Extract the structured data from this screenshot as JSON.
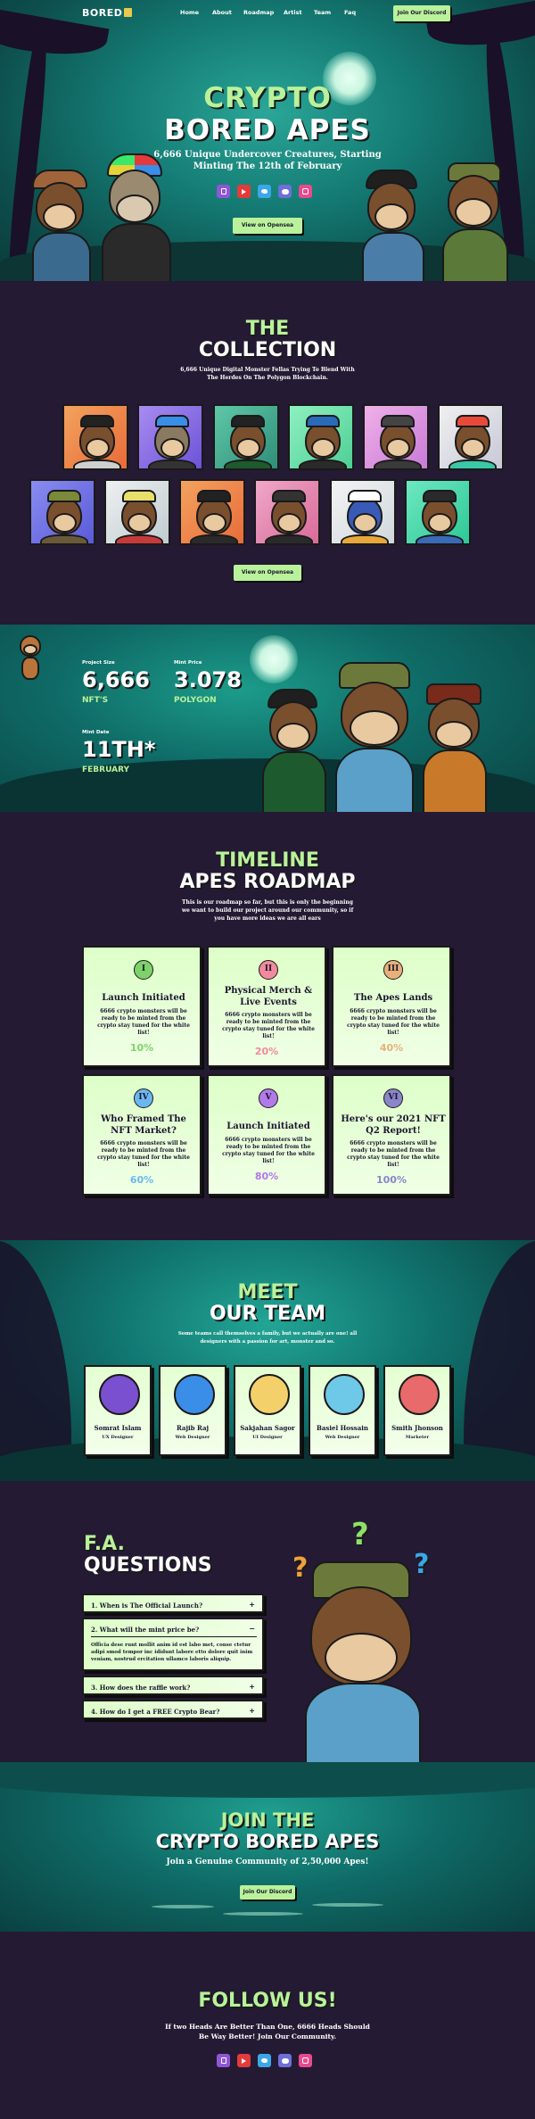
{
  "nav": {
    "logo": "BORED",
    "links": [
      "Home",
      "About",
      "Roadmap",
      "Artist",
      "Team",
      "Faq"
    ],
    "cta": "Join Our Discord"
  },
  "hero": {
    "title_line1": "CRYPTO",
    "title_line2": "BORED APES",
    "subtitle_line1": "6,666 Unique Undercover Creatures, Starting",
    "subtitle_line2": "Minting The 12th of February",
    "social_icons": [
      "twitch-icon",
      "youtube-icon",
      "twitter-icon",
      "discord-icon",
      "instagram-icon"
    ],
    "cta": "View on Opensea"
  },
  "collection": {
    "title_line1": "THE",
    "title_line2": "COLLECTION",
    "desc_line1": "6,666 Unique Digital Monster Fellas Trying To Blend With",
    "desc_line2": "The Herdes On The Polygon Blockchain.",
    "cta": "View on Opensea"
  },
  "stats": {
    "project_size_label": "Project Size",
    "project_size_value": "6,666",
    "project_size_unit": "NFT'S",
    "mint_price_label": "Mint Price",
    "mint_price_value": "3.078",
    "mint_price_unit": "POLYGON",
    "mint_date_label": "Mint Date",
    "mint_date_value": "11TH*",
    "mint_date_unit": "FEBRUARY"
  },
  "roadmap": {
    "title_line1": "TIMELINE",
    "title_line2": "APES ROADMAP",
    "desc_line1": "This is our roadmap so far, but this is only the beginning",
    "desc_line2": "we want to build our project around our community, so if",
    "desc_line3": "you have more ideas we are all ears",
    "items": [
      {
        "num": "I",
        "title": "Launch Initiated",
        "desc": "6666 crypto monsters will be ready to be minted from the crypto stay tuned for the white list!",
        "pct": "10%",
        "color": "#7dd36a"
      },
      {
        "num": "II",
        "title": "Physical Merch & Live Events",
        "desc": "6666 crypto monsters will be ready to be minted from the crypto stay tuned for the white list!",
        "pct": "20%",
        "color": "#f08a9c"
      },
      {
        "num": "III",
        "title": "The Apes Lands",
        "desc": "6666 crypto monsters will be ready to be minted from the crypto stay tuned for the white list!",
        "pct": "40%",
        "color": "#e8b07a"
      },
      {
        "num": "IV",
        "title": "Who Framed The NFT Market?",
        "desc": "6666 crypto monsters will be ready to be minted from the crypto stay tuned for the white list!",
        "pct": "60%",
        "color": "#6bb8f0"
      },
      {
        "num": "V",
        "title": "Launch Initiated",
        "desc": "6666 crypto monsters will be ready to be minted from the crypto stay tuned for the white list!",
        "pct": "80%",
        "color": "#b279e8"
      },
      {
        "num": "VI",
        "title": "Here's our 2021 NFT Q2 Report!",
        "desc": "6666 crypto monsters will be ready to be minted from the crypto stay tuned for the white list!",
        "pct": "100%",
        "color": "#8a86c8"
      }
    ]
  },
  "team": {
    "title_line1": "MEET",
    "title_line2": "OUR TEAM",
    "desc_line1": "Some teams call themselves a family, but we actually are one! all",
    "desc_line2": "designers with a passion for art, monster and so.",
    "members": [
      {
        "name": "Somrat Islam",
        "role": "UX Designer"
      },
      {
        "name": "Rajib Raj",
        "role": "Web Designer"
      },
      {
        "name": "Sakjahan Sagor",
        "role": "UI Designer"
      },
      {
        "name": "Basiel Hossain",
        "role": "Web Designer"
      },
      {
        "name": "Smith Jhonson",
        "role": "Marketer"
      }
    ]
  },
  "faq": {
    "title_line1": "F.A.",
    "title_line2": "QUESTIONS",
    "items": [
      {
        "q": "1. When is The Official Launch?",
        "a": ""
      },
      {
        "q": "2. What will the mint price be?",
        "a": "Officia dese runt mollit anim id est labo met, conse ctetur adipi smod tempor inc ididunt labore etto dolore quit inim veniam, nostrud ercitation ullamco laboris aliquip."
      },
      {
        "q": "3. How does the raffle work?",
        "a": ""
      },
      {
        "q": "4. How do I get a FREE Crypto Bear?",
        "a": ""
      }
    ]
  },
  "join": {
    "title_line1": "JOIN THE",
    "title_line2": "CRYPTO BORED APES",
    "subtitle": "Join a Genuine Community of 2,50,000 Apes!",
    "cta": "Join Our Discord"
  },
  "follow": {
    "title": "FOLLOW US!",
    "desc_line1": "If two Heads Are Better Than One, 6666 Heads Should",
    "desc_line2": "Be Way Better! Join Our Community.",
    "social_icons": [
      "twitch-icon",
      "youtube-icon",
      "twitter-icon",
      "discord-icon",
      "instagram-icon"
    ]
  },
  "colors": {
    "accent_green": "#b9f29a",
    "background": "#241a33",
    "teal": "#147a73"
  }
}
